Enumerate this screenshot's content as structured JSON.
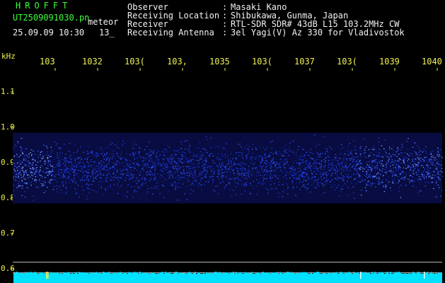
{
  "header": {
    "brand": "HROFFT",
    "filename": "UT2509091030.pn",
    "meteor_label": "meteor",
    "datetime": "25.09.09 10:30",
    "count": "13_"
  },
  "info": [
    {
      "label": "Observer",
      "sep": ":",
      "value": "Masaki Kano"
    },
    {
      "label": "Receiving Location",
      "sep": ":",
      "value": "Shibukawa, Gunma, Japan"
    },
    {
      "label": "Receiver",
      "sep": ":",
      "value": "RTL-SDR SDR# 43dB L15 103.2MHz CW"
    },
    {
      "label": "Receiving Antenna",
      "sep": ":",
      "value": "3el Yagi(V) Az 330 for Vladivostok"
    }
  ],
  "axes": {
    "y_unit": "kHz",
    "y_ticks": [
      "1.1",
      "1.0",
      "0.9",
      "0.8",
      "0.7",
      "0.6"
    ],
    "x_ticks": [
      "103",
      "1032",
      "103(",
      "103,",
      "1035",
      "103(",
      "1037",
      "103(",
      "1039",
      "1040"
    ]
  },
  "colors": {
    "text_green": "#3cff3c",
    "text_yellow": "#f0f050",
    "noise_band": "#2030d0",
    "status_bar": "#00e0ff"
  },
  "spectrogram": {
    "band_top_khz": 0.985,
    "band_bottom_khz": 0.785,
    "reference_lines_khz": [
      0.62,
      0.59
    ]
  }
}
